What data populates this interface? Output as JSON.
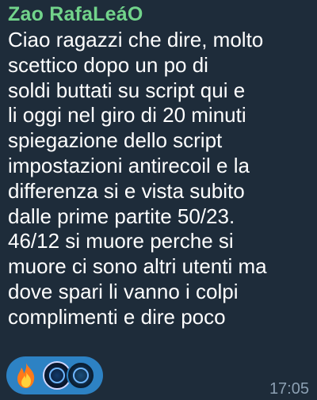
{
  "message": {
    "sender": "Zao RafaLeáO",
    "lines": [
      "Ciao ragazzi che dire, molto",
      "scettico dopo un po di",
      "soldi buttati su script qui e",
      "li oggi nel giro di 20 minuti",
      "spiegazione dello script",
      "impostazioni antirecoil e la",
      "differenza si e vista subito",
      "dalle prime partite 50/23.",
      "46/12 si muore perche si",
      "muore ci sono altri utenti ma",
      "dove spari li vanno i colpi",
      "complimenti e dire poco"
    ],
    "time": "17:05"
  },
  "reactions": {
    "emoji": "fire-emoji",
    "reactor_avatars": [
      "avatar",
      "avatar"
    ]
  },
  "colors": {
    "bubble_bg": "#1e2c3a",
    "sender_name": "#72d48b",
    "text": "#ffffff",
    "reaction_pill": "#2d82c4",
    "timestamp": "#8ca0b3"
  }
}
